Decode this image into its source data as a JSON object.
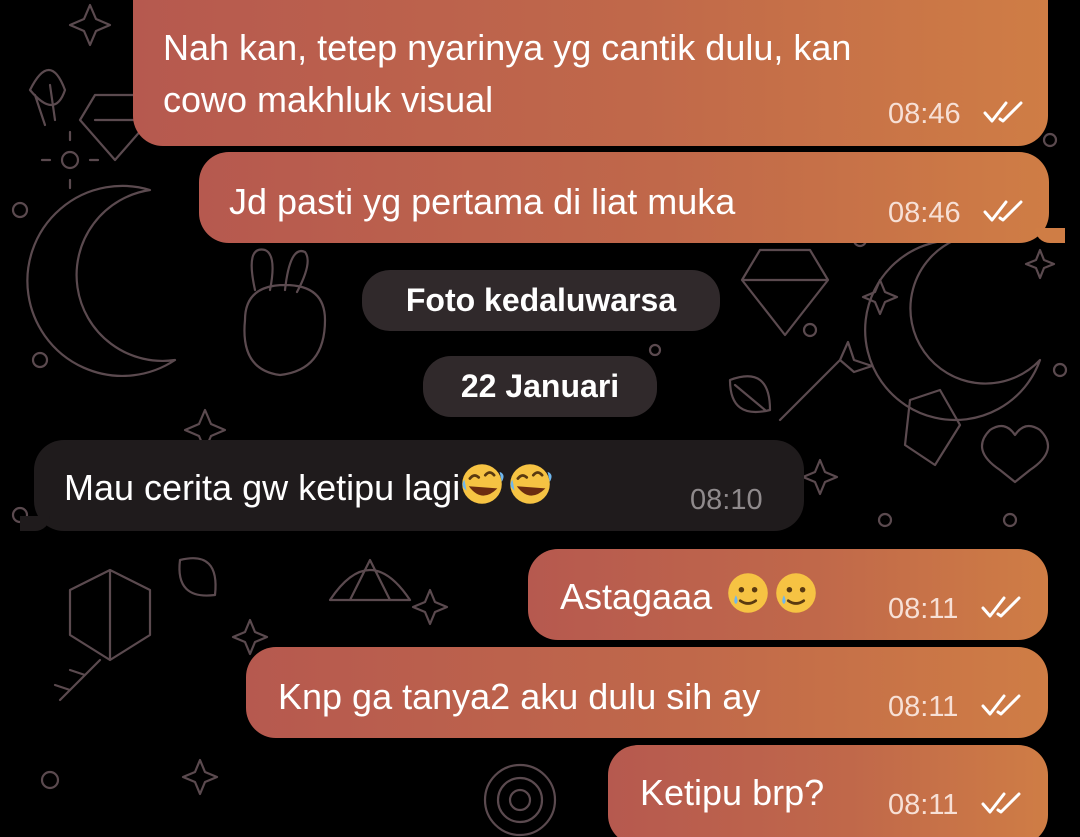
{
  "messages": [
    {
      "text_line1": "Nah kan, tetep nyarinya yg cantik dulu, kan",
      "text_line2": "cowo makhluk visual",
      "time": "08:46"
    },
    {
      "text": "Jd pasti yg pertama di liat muka",
      "time": "08:46"
    },
    {
      "text": "Mau cerita gw ketipu lagi",
      "time": "08:10",
      "emoji": [
        "rolling-on-floor-laughing",
        "rolling-on-floor-laughing"
      ]
    },
    {
      "text": "Astagaaa",
      "time": "08:11",
      "emoji": [
        "smiling-face-with-tear",
        "smiling-face-with-tear"
      ]
    },
    {
      "text": "Knp ga tanya2 aku dulu sih ay",
      "time": "08:11"
    },
    {
      "text": "Ketipu brp?",
      "time": "08:11"
    }
  ],
  "service_notes": {
    "expired_photo": "Foto kedaluwarsa",
    "date_separator": "22 Januari"
  },
  "colors": {
    "background": "#000000",
    "outgoing_start": "#b6594f",
    "outgoing_end": "#cf7d45",
    "incoming": "#1f1b1c",
    "pill": "#342c2e"
  },
  "icons": [
    "double-check-icon",
    "rolling-on-floor-laughing-emoji",
    "smiling-face-with-tear-emoji"
  ]
}
